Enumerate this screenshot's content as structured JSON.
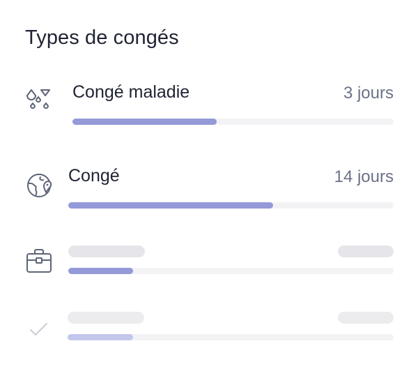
{
  "panel": {
    "title": "Types de congés"
  },
  "leave_types": [
    {
      "icon": "drops-icon",
      "label": "Congé maladie",
      "value": "3 jours",
      "progress": 0.45
    },
    {
      "icon": "globe-icon",
      "label": "Congé",
      "value": "14 jours",
      "progress": 0.63
    },
    {
      "icon": "briefcase-icon",
      "label": "",
      "value": "",
      "progress": 0.2,
      "loading": true
    },
    {
      "icon": "check-icon",
      "label": "",
      "value": "",
      "progress": 0.2,
      "loading": true,
      "faded": true
    }
  ],
  "colors": {
    "accent": "#9499d8",
    "accent_faded": "#c4c7ec",
    "track": "#f3f3f5",
    "skeleton": "#e6e6ea",
    "text": "#1f2333",
    "muted": "#6a7287"
  }
}
